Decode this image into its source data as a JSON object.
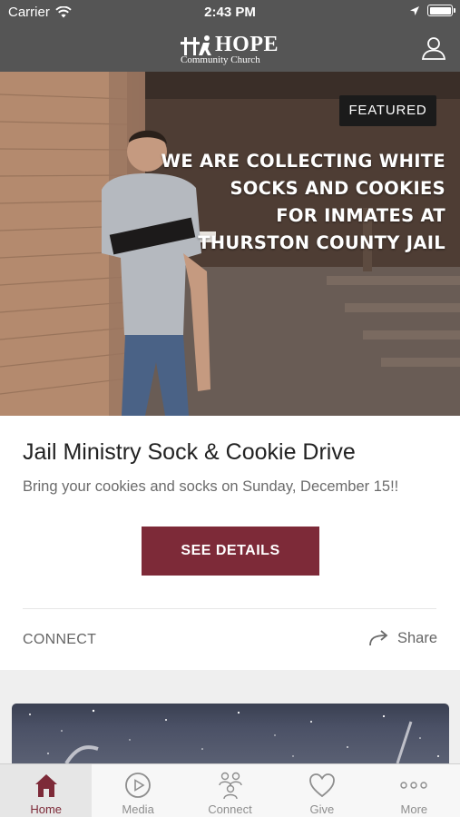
{
  "status_bar": {
    "carrier": "Carrier",
    "time": "2:43 PM"
  },
  "nav_bar": {
    "logo_word": "HOPE",
    "logo_sub": "Community Church"
  },
  "featured": {
    "badge": "FEATURED",
    "image_text": "WE ARE COLLECTING  WHITE\nSOCKS  AND COOKIES\nFOR  INMATES AT\nTHURSTON COUNTY  JAIL",
    "title": "Jail Ministry Sock & Cookie Drive",
    "subtitle": "Bring your cookies and socks on Sunday, December 15!!",
    "button_label": "SEE DETAILS",
    "category": "CONNECT",
    "share_label": "Share"
  },
  "tabs": [
    {
      "label": "Home",
      "icon": "home-icon",
      "active": true
    },
    {
      "label": "Media",
      "icon": "play-circle-icon",
      "active": false
    },
    {
      "label": "Connect",
      "icon": "people-icon",
      "active": false
    },
    {
      "label": "Give",
      "icon": "heart-icon",
      "active": false
    },
    {
      "label": "More",
      "icon": "more-dots-icon",
      "active": false
    }
  ],
  "colors": {
    "header": "#555555",
    "accent": "#7d2a38",
    "badge": "#1b1b1b"
  }
}
